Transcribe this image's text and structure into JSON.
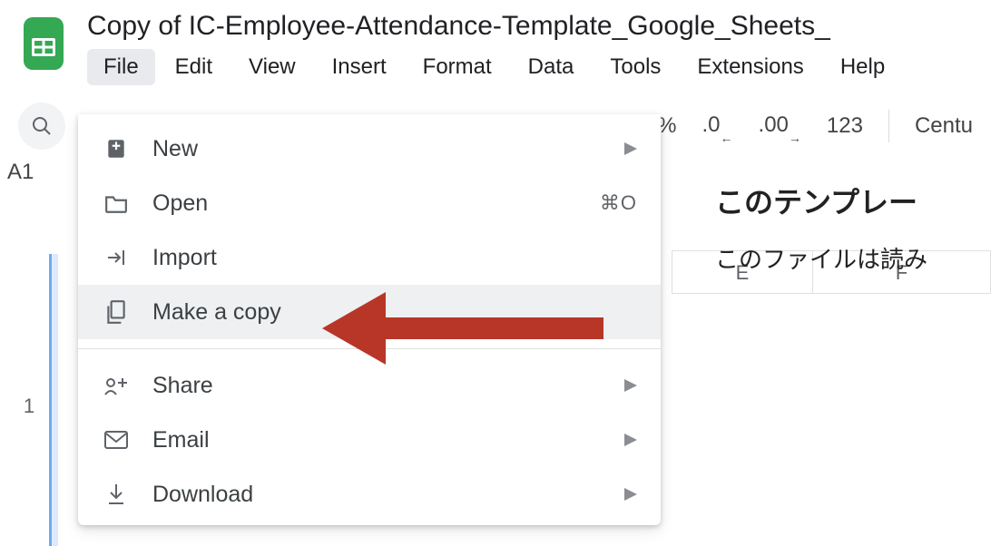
{
  "header": {
    "doc_title": "Copy of IC-Employee-Attendance-Template_Google_Sheets_",
    "menu": [
      "File",
      "Edit",
      "View",
      "Insert",
      "Format",
      "Data",
      "Tools",
      "Extensions",
      "Help"
    ],
    "active_menu_index": 0
  },
  "toolbar": {
    "percent_label": "%",
    "decimal_dec": ".0",
    "decimal_inc": ".00",
    "format_123": "123",
    "font": "Centu"
  },
  "cell_ref": "A1",
  "dropdown": {
    "items": [
      {
        "icon": "new-doc-icon",
        "label": "New",
        "submenu": true
      },
      {
        "icon": "folder-icon",
        "label": "Open",
        "shortcut": "⌘O"
      },
      {
        "icon": "import-icon",
        "label": "Import"
      },
      {
        "icon": "copy-icon",
        "label": "Make a copy",
        "hovered": true
      },
      {
        "separator": true
      },
      {
        "icon": "share-icon",
        "label": "Share",
        "submenu": true
      },
      {
        "icon": "email-icon",
        "label": "Email",
        "submenu": true
      },
      {
        "icon": "download-icon",
        "label": "Download",
        "submenu": true
      }
    ]
  },
  "columns": [
    "E",
    "F"
  ],
  "row_numbers": [
    "1"
  ],
  "content": {
    "heading": "このテンプレー",
    "body": "このファイルは読み"
  }
}
